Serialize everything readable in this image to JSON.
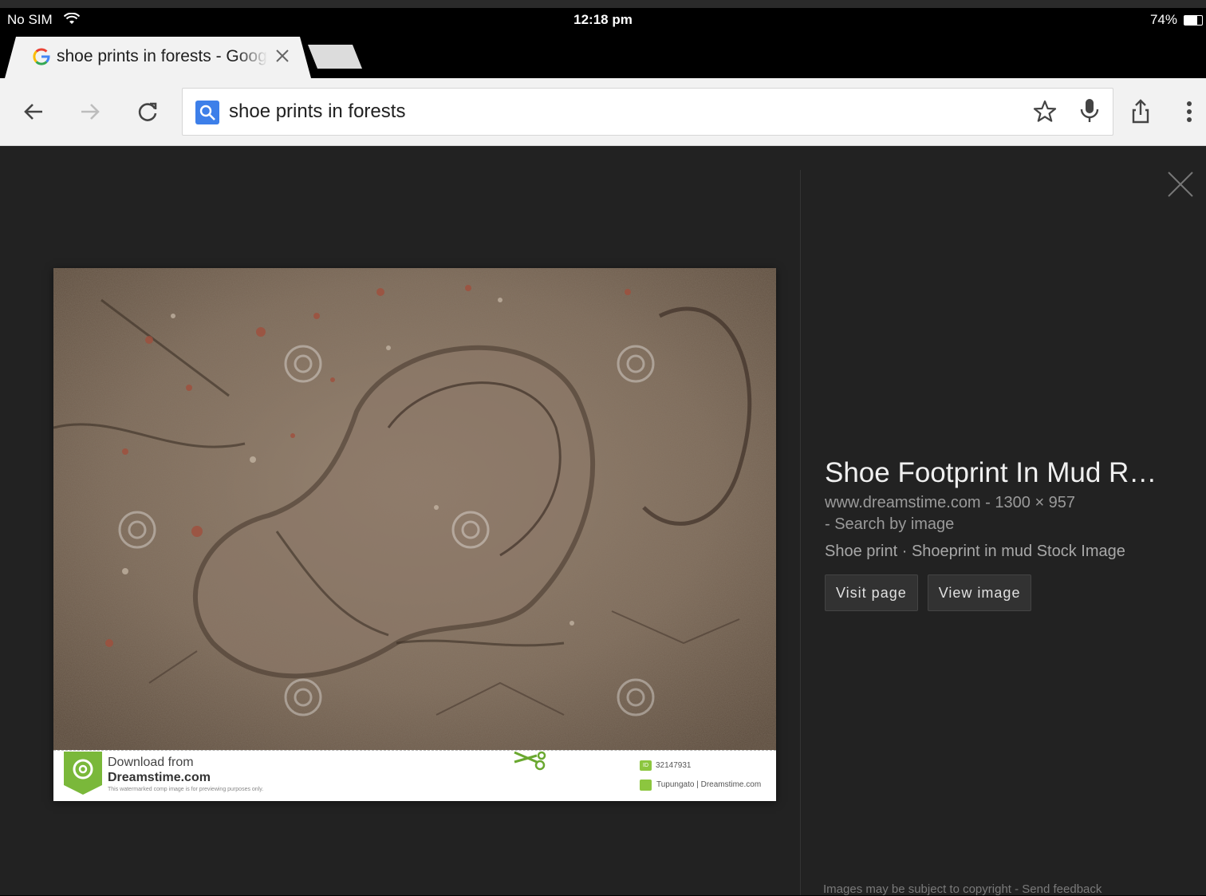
{
  "status_bar": {
    "carrier": "No SIM",
    "time": "12:18 pm",
    "battery": "74%"
  },
  "tab": {
    "title": "shoe prints in forests - Google Search"
  },
  "toolbar": {
    "query": "shoe prints in forests"
  },
  "image": {
    "download_line1": "Download from",
    "download_line2": "Dreamstime.com",
    "download_note": "This watermarked comp image is for previewing purposes only.",
    "id_badge": "ID",
    "id_number": "32147931",
    "credit": "Tupungato | Dreamstime.com"
  },
  "info": {
    "title": "Shoe Footprint In Mud R…",
    "source": "www.dreamstime.com",
    "separator": " - ",
    "dimensions": "1300 × 957",
    "search_by_image": " - Search by image",
    "description": "Shoe print · Shoeprint in mud Stock Image",
    "visit_label": "Visit page",
    "view_label": "View image"
  },
  "footer": {
    "copyright": "Images may be subject to copyright",
    "sep": " - ",
    "feedback": "Send feedback"
  }
}
